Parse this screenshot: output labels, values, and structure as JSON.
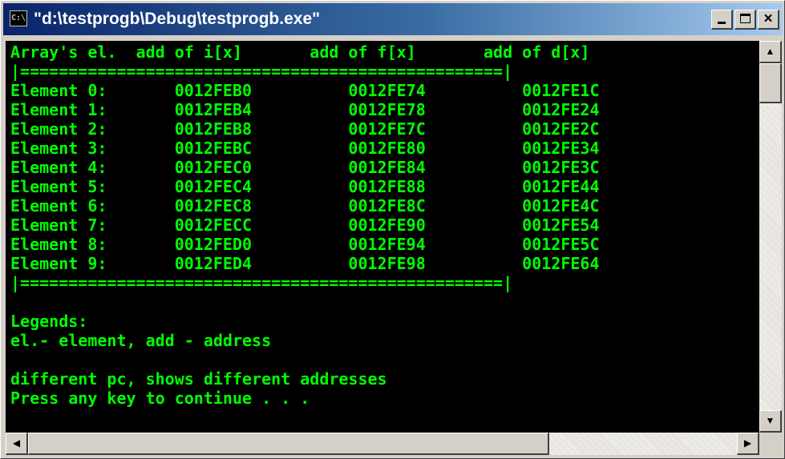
{
  "window": {
    "title": "\"d:\\testprogb\\Debug\\testprogb.exe\"",
    "icon_label": "C:\\"
  },
  "caption_buttons": {
    "minimize_icon": "minimize-icon",
    "maximize_icon": "maximize-icon",
    "close_glyph": "×"
  },
  "console": {
    "text_color": "#00ff00",
    "background": "#000000",
    "lines": [
      "Array's el.  add of i[x]       add of f[x]       add of d[x]",
      "|==================================================|",
      "Element 0:       0012FEB0          0012FE74          0012FE1C",
      "Element 1:       0012FEB4          0012FE78          0012FE24",
      "Element 2:       0012FEB8          0012FE7C          0012FE2C",
      "Element 3:       0012FEBC          0012FE80          0012FE34",
      "Element 4:       0012FEC0          0012FE84          0012FE3C",
      "Element 5:       0012FEC4          0012FE88          0012FE44",
      "Element 6:       0012FEC8          0012FE8C          0012FE4C",
      "Element 7:       0012FECC          0012FE90          0012FE54",
      "Element 8:       0012FED0          0012FE94          0012FE5C",
      "Element 9:       0012FED4          0012FE98          0012FE64",
      "|==================================================|",
      "",
      "Legends:",
      "el.- element, add - address",
      "",
      "different pc, shows different addresses",
      "Press any key to continue . . ."
    ]
  },
  "scrollbars": {
    "up_arrow": "▲",
    "down_arrow": "▼",
    "left_arrow": "◀",
    "right_arrow": "▶"
  }
}
